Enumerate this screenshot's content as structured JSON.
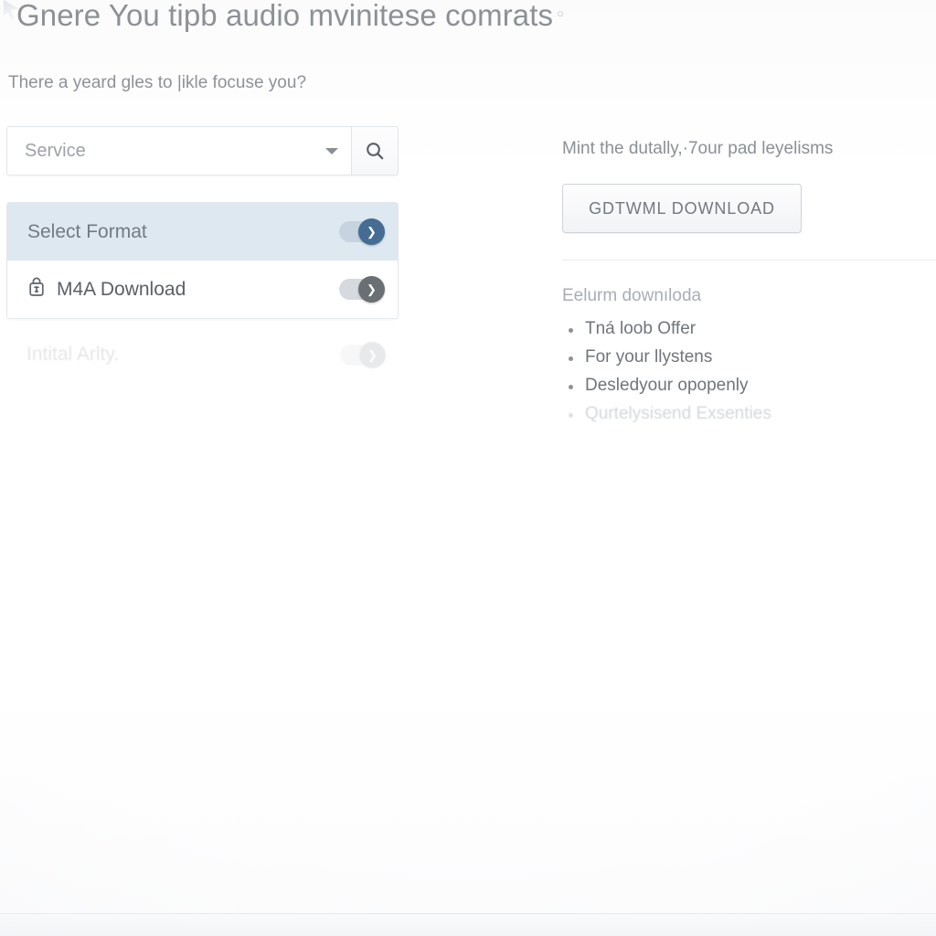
{
  "page": {
    "heading": "Gnere You tipb audio mvinitese comrats",
    "heading_suffix": "○",
    "subheading": "There a yeard gles to |ikle focuse you?"
  },
  "left_panel": {
    "service_select": {
      "value": "Service",
      "placeholder": "Service",
      "caret_icon": "chevron-down-icon"
    },
    "search_button": {
      "icon": "search-icon"
    },
    "format_rows": [
      {
        "label": "Select Format",
        "icon": null,
        "selected": true,
        "toggle_state": "on",
        "toggle_color": "#456c92",
        "knob_glyph": "❯"
      },
      {
        "label": "M4A Download",
        "icon": "lock-icon",
        "selected": false,
        "toggle_state": "on",
        "toggle_color": "#6a6f74",
        "knob_glyph": "❯"
      }
    ],
    "ghost_row": {
      "label": "Intital Arlty.",
      "toggle_state": "on",
      "knob_glyph": "❯"
    }
  },
  "right_panel": {
    "lead_text": "Mint the dutally,·7our pad leyelisms",
    "download_button_label": "GDTWML DOWNLOAD",
    "list_title": "Eelurm downıloda",
    "bullets": [
      {
        "text": "Tná loob Offer",
        "faded": false
      },
      {
        "text": "For your llystens",
        "faded": false
      },
      {
        "text": "Desledyour opopenly",
        "faded": false
      },
      {
        "text": "Qurtelysisend Exsenties",
        "faded": true
      }
    ]
  },
  "theme": {
    "background": "#ffffff",
    "selected_row_bg": "#dde8f1",
    "accent": "#456c92",
    "muted_text": "#8b9096",
    "body_text": "#5b6066",
    "border": "#e2e5e8"
  }
}
